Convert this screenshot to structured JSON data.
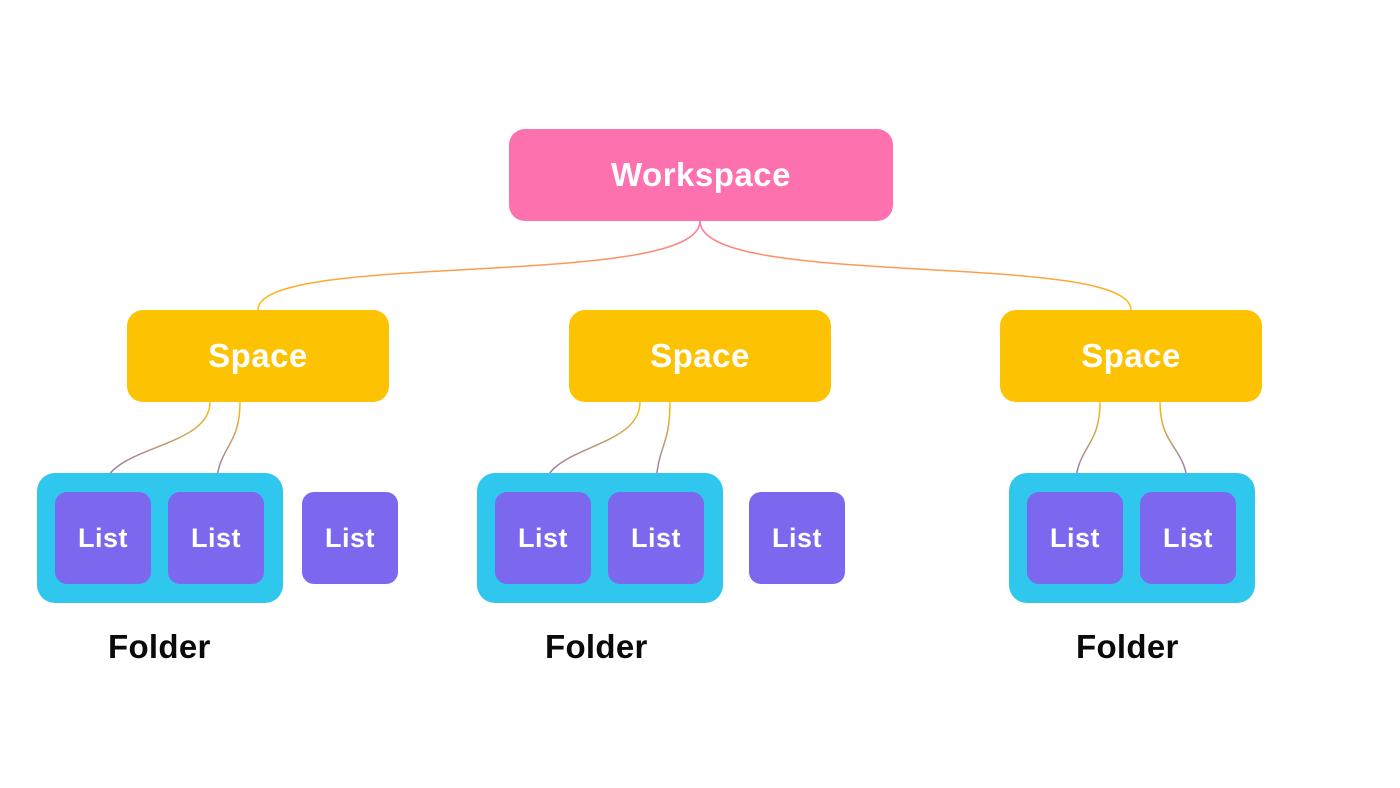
{
  "hierarchy": {
    "workspace": {
      "label": "Workspace",
      "color": "#fd71af"
    },
    "spaces": [
      {
        "label": "Space",
        "color": "#fdc201"
      },
      {
        "label": "Space",
        "color": "#fdc201"
      },
      {
        "label": "Space",
        "color": "#fdc201"
      }
    ],
    "folders": [
      {
        "label": "Folder",
        "color": "#30c7ee",
        "lists": [
          {
            "label": "List"
          },
          {
            "label": "List"
          }
        ],
        "standalone_lists": [
          {
            "label": "List"
          }
        ]
      },
      {
        "label": "Folder",
        "color": "#30c7ee",
        "lists": [
          {
            "label": "List"
          },
          {
            "label": "List"
          }
        ],
        "standalone_lists": [
          {
            "label": "List"
          }
        ]
      },
      {
        "label": "Folder",
        "color": "#30c7ee",
        "lists": [
          {
            "label": "List"
          },
          {
            "label": "List"
          }
        ],
        "standalone_lists": []
      }
    ],
    "list_color": "#7b68ee"
  }
}
